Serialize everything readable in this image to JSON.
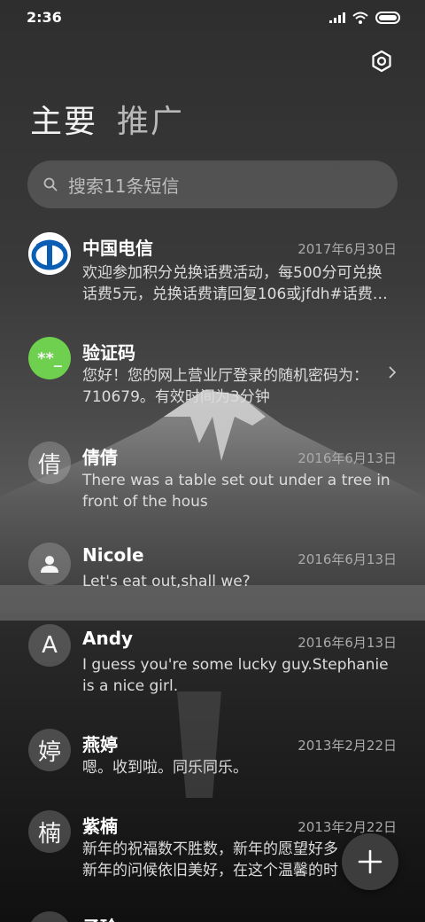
{
  "status_bar": {
    "time": "2:36"
  },
  "tabs": [
    {
      "label": "主要",
      "active": true
    },
    {
      "label": "推广",
      "active": false
    }
  ],
  "search": {
    "placeholder": "搜索11条短信"
  },
  "conversations": [
    {
      "name": "中国电信",
      "date": "2017年6月30日",
      "line1": "欢迎参加积分兑换话费活动，每500分可兑换",
      "line2": "话费5元，兑换话费请回复106或jfdh#话费…",
      "avatar_type": "logo",
      "avatar_text": ""
    },
    {
      "name": "验证码",
      "date": "",
      "line1": "您好！您的网上营业厅登录的随机密码为：",
      "line2": "710679。有效时间为3分钟",
      "avatar_type": "code",
      "avatar_text": "**_"
    },
    {
      "name": "倩倩",
      "date": "2016年6月13日",
      "line1": "There was a table set out under a tree in",
      "line2": "front of the hous",
      "avatar_type": "char",
      "avatar_text": "倩"
    },
    {
      "name": "Nicole",
      "date": "2016年6月13日",
      "line1": "Let's eat out,shall we?",
      "line2": "",
      "avatar_type": "person",
      "avatar_text": ""
    },
    {
      "name": "Andy",
      "date": "2016年6月13日",
      "line1": "I guess you're some lucky guy.Stephanie",
      "line2": "is a nice girl.",
      "avatar_type": "char",
      "avatar_text": "A"
    },
    {
      "name": "燕婷",
      "date": "2013年2月22日",
      "line1": "嗯。收到啦。同乐同乐。",
      "line2": "",
      "avatar_type": "char",
      "avatar_text": "婷"
    },
    {
      "name": "紫楠",
      "date": "2013年2月22日",
      "line1": "新年的祝福数不胜数，新年的愿望好多",
      "line2": "新年的问候依旧美好，在这个温馨的时",
      "avatar_type": "char",
      "avatar_text": "楠"
    },
    {
      "name": "子玲",
      "date": "",
      "line1": "",
      "line2": "",
      "avatar_type": "char",
      "avatar_text": ""
    }
  ],
  "colors": {
    "code_avatar": "#6fcf4f",
    "telecom_blue": "#0a5fb4"
  }
}
